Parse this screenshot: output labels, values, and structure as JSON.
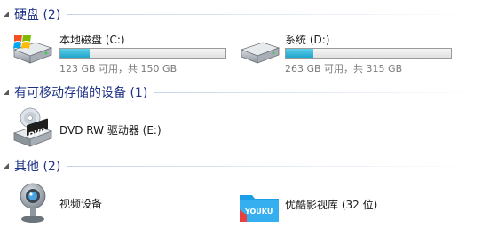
{
  "groups": {
    "hard_disks": {
      "title": "硬盘 (2)"
    },
    "removable": {
      "title": "有可移动存储的设备 (1)"
    },
    "other": {
      "title": "其他 (2)"
    }
  },
  "drives": [
    {
      "label": "本地磁盘 (C:)",
      "space": "123 GB 可用，共 150 GB",
      "used_fraction": 0.18
    },
    {
      "label": "系统 (D:)",
      "space": "263 GB 可用，共 315 GB",
      "used_fraction": 0.165
    }
  ],
  "removable_devices": [
    {
      "label": "DVD RW 驱动器 (E:)",
      "icon_text": "DVD"
    }
  ],
  "other_items": [
    {
      "label": "视频设备"
    },
    {
      "label": "优酷影视库 (32 位)",
      "icon_text": "YOUKU"
    }
  ],
  "colors": {
    "group_title": "#1e3287",
    "bar_fill": "#26b0d6",
    "youku_blue": "#1a9ee8",
    "youku_red": "#e8403c"
  }
}
